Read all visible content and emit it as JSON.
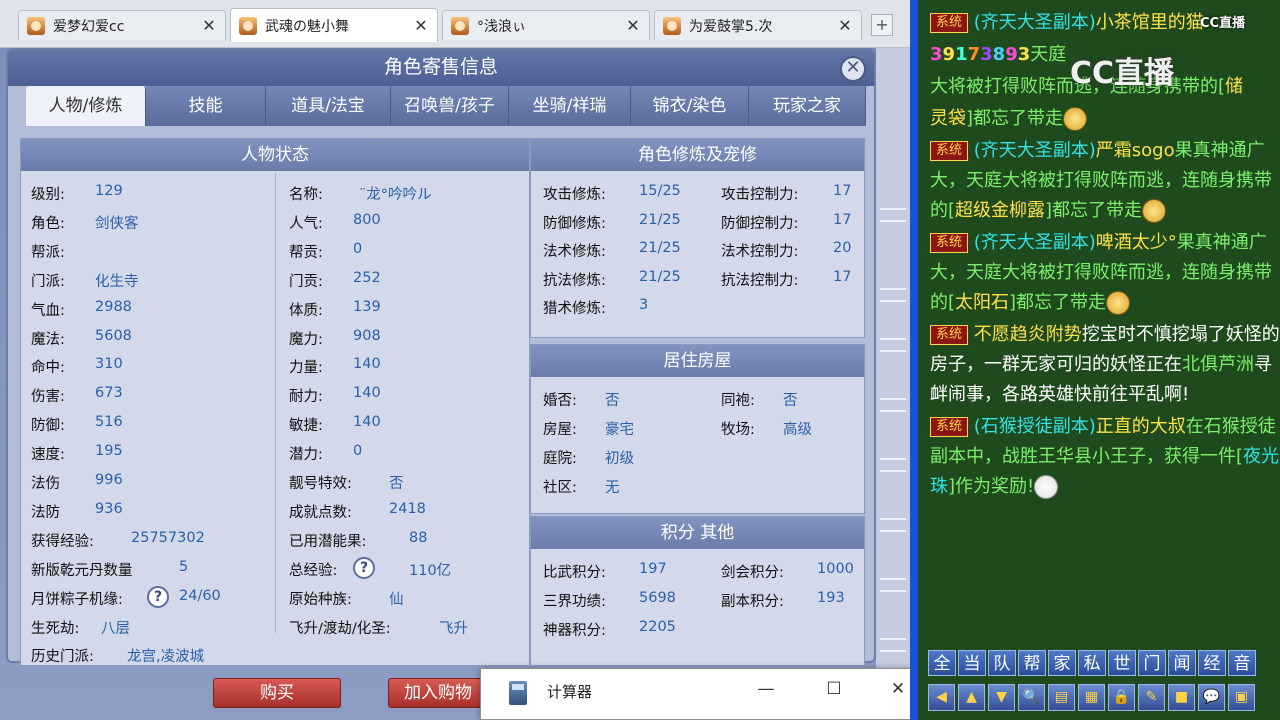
{
  "browser_tabs": [
    {
      "label": "爱梦幻爱cc",
      "active": false
    },
    {
      "label": "武魂の魅小舞",
      "active": true
    },
    {
      "label": "°浅浪ぃ",
      "active": false
    },
    {
      "label": "为爱鼓掌5.次",
      "active": false
    }
  ],
  "new_tab": "+",
  "dialog": {
    "title": "角色寄售信息",
    "close": "✕",
    "tabs": [
      "人物/修炼",
      "技能",
      "道具/法宝",
      "召唤兽/孩子",
      "坐骑/祥瑞",
      "锦衣/染色",
      "玩家之家"
    ]
  },
  "status_panel": {
    "title": "人物状态",
    "left": [
      {
        "label": "级别:",
        "value": "129"
      },
      {
        "label": "角色:",
        "value": "剑侠客"
      },
      {
        "label": "帮派:",
        "value": ""
      },
      {
        "label": "门派:",
        "value": "化生寺"
      },
      {
        "label": "气血:",
        "value": "2988"
      },
      {
        "label": "魔法:",
        "value": "5608"
      },
      {
        "label": "命中:",
        "value": "310"
      },
      {
        "label": "伤害:",
        "value": "673"
      },
      {
        "label": "防御:",
        "value": "516"
      },
      {
        "label": "速度:",
        "value": "195"
      },
      {
        "label": "法伤",
        "value": "996"
      },
      {
        "label": "法防",
        "value": "936"
      },
      {
        "label": "获得经验:",
        "value": "25757302"
      },
      {
        "label": "新版乾元丹数量",
        "value": "5"
      },
      {
        "label": "月饼粽子机缘:",
        "value": "24/60"
      },
      {
        "label": "生死劫:",
        "value": "八层"
      },
      {
        "label": "历史门派:",
        "value": "龙宫,凌波城"
      }
    ],
    "right": [
      {
        "label": "名称:",
        "value": "¨龙°吟吟ル"
      },
      {
        "label": "人气:",
        "value": "800"
      },
      {
        "label": "帮贡:",
        "value": "0"
      },
      {
        "label": "门贡:",
        "value": "252"
      },
      {
        "label": "体质:",
        "value": "139"
      },
      {
        "label": "魔力:",
        "value": "908"
      },
      {
        "label": "力量:",
        "value": "140"
      },
      {
        "label": "耐力:",
        "value": "140"
      },
      {
        "label": "敏捷:",
        "value": "140"
      },
      {
        "label": "潜力:",
        "value": "0"
      },
      {
        "label": "靓号特效:",
        "value": "否"
      },
      {
        "label": "成就点数:",
        "value": "2418"
      },
      {
        "label": "已用潜能果:",
        "value": "88"
      },
      {
        "label": "总经验:",
        "value": "110亿"
      },
      {
        "label": "原始种族:",
        "value": "仙"
      },
      {
        "label": "飞升/渡劫/化圣:",
        "value": "飞升"
      }
    ]
  },
  "cultivation_panel": {
    "title": "角色修炼及宠修",
    "rows": [
      {
        "l1": "攻击修炼:",
        "v1": "15/25",
        "l2": "攻击控制力:",
        "v2": "17"
      },
      {
        "l1": "防御修炼:",
        "v1": "21/25",
        "l2": "防御控制力:",
        "v2": "17"
      },
      {
        "l1": "法术修炼:",
        "v1": "21/25",
        "l2": "法术控制力:",
        "v2": "20"
      },
      {
        "l1": "抗法修炼:",
        "v1": "21/25",
        "l2": "抗法控制力:",
        "v2": "17"
      },
      {
        "l1": "猎术修炼:",
        "v1": "3",
        "l2": "",
        "v2": ""
      }
    ]
  },
  "house_panel": {
    "title": "居住房屋",
    "rows": [
      {
        "l1": "婚否:",
        "v1": "否",
        "l2": "同袍:",
        "v2": "否"
      },
      {
        "l1": "房屋:",
        "v1": "豪宅",
        "l2": "牧场:",
        "v2": "高级"
      },
      {
        "l1": "庭院:",
        "v1": "初级",
        "l2": "",
        "v2": ""
      },
      {
        "l1": "社区:",
        "v1": "无",
        "l2": "",
        "v2": ""
      }
    ]
  },
  "points_panel": {
    "title": "积分 其他",
    "rows": [
      {
        "l1": "比武积分:",
        "v1": "197",
        "l2": "剑会积分:",
        "v2": "1000"
      },
      {
        "l1": "三界功绩:",
        "v1": "5698",
        "l2": "副本积分:",
        "v2": "193"
      },
      {
        "l1": "神器积分:",
        "v1": "2205",
        "l2": "",
        "v2": ""
      }
    ]
  },
  "buttons": {
    "buy": "购买",
    "add_cart": "加入购物"
  },
  "help_mark": "?",
  "calculator": {
    "title": "计算器",
    "minimize": "—",
    "maximize": "☐",
    "close": "✕"
  },
  "chat": {
    "system_tag": "系统",
    "messages": [
      {
        "parts": [
          [
            "cyan",
            "(齐天大圣副本)"
          ],
          [
            "yellow",
            "小茶馆里的猫"
          ]
        ]
      },
      {
        "parts": [
          [
            "rainbow",
            "39173893"
          ],
          [
            "green",
            "天庭"
          ]
        ]
      },
      {
        "parts": [
          [
            "green",
            "大将被打得败阵而逃，连随身携带的["
          ],
          [
            "yellow",
            "储"
          ]
        ]
      },
      {
        "parts": [
          [
            "yellow",
            "灵袋"
          ],
          [
            "green",
            "]都忘了带走"
          ]
        ]
      },
      {
        "parts": [
          [
            "cyan",
            "(齐天大圣副本)"
          ],
          [
            "yellow",
            "严霜sogo"
          ],
          [
            "green",
            "果真神通广大，天庭大将被打得败阵而逃，连随身携带的["
          ],
          [
            "yellow",
            "超级金柳露"
          ],
          [
            "green",
            "]都忘了带走"
          ]
        ]
      },
      {
        "parts": [
          [
            "cyan",
            "(齐天大圣副本)"
          ],
          [
            "yellow",
            "啤酒太少°"
          ],
          [
            "green",
            "果真神通广大，天庭大将被打得败阵而逃，连随身携带的["
          ],
          [
            "yellow",
            "太阳石"
          ],
          [
            "green",
            "]都忘了带走"
          ]
        ]
      },
      {
        "parts": [
          [
            "yellow",
            "不愿趋炎附势"
          ],
          [
            "white",
            "挖宝时不慎挖塌了妖怪的房子，一群无家可归的妖怪正在"
          ],
          [
            "green",
            "北俱芦洲"
          ],
          [
            "white",
            "寻衅闹事，各路英雄快前往平乱啊!"
          ]
        ]
      },
      {
        "parts": [
          [
            "cyan",
            "(石猴授徒副本)"
          ],
          [
            "yellow",
            "正直的大叔"
          ],
          [
            "green",
            "在石猴授徒副本中，战胜王华县小王子，获得一件["
          ],
          [
            "cyan",
            "夜光珠"
          ],
          [
            "green",
            "]作为奖励!"
          ]
        ]
      }
    ],
    "watermark": "CC直播",
    "watermark_small": "CC直播",
    "channels": [
      "全",
      "当",
      "队",
      "帮",
      "家",
      "私",
      "世",
      "门",
      "闻",
      "经",
      "音"
    ],
    "tool_icons": [
      "◀",
      "▲",
      "▼",
      "🔍",
      "▤",
      "▦",
      "🔒",
      "✎",
      "■",
      "💬",
      "▣"
    ]
  }
}
